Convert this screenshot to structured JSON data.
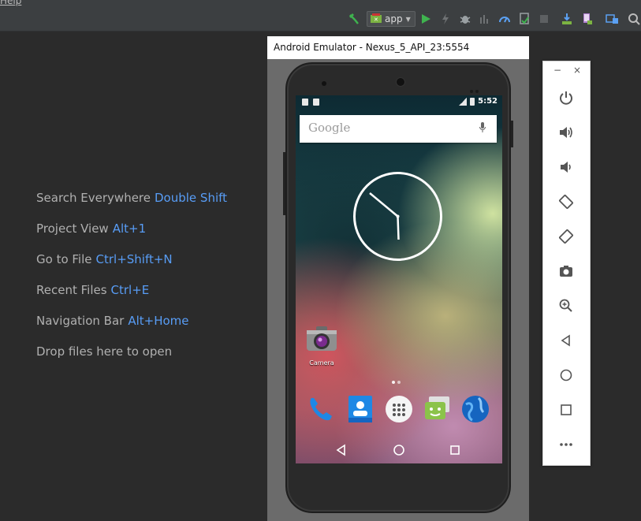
{
  "menubar": {
    "help_label": "Help"
  },
  "toolbar": {
    "run_config": "app",
    "icons": [
      "make-project-icon",
      "run-config-android-icon",
      "run-icon",
      "debug-lightning-icon",
      "debug-bug-icon",
      "profile-icon",
      "sync-icon",
      "coverage-icon",
      "device-stop-icon",
      "sdk-manager-icon",
      "avd-manager-icon",
      "project-structure-icon",
      "search-icon"
    ]
  },
  "welcome": {
    "hints": [
      {
        "label": "Search Everywhere",
        "key": "Double Shift"
      },
      {
        "label": "Project View",
        "key": "Alt+1"
      },
      {
        "label": "Go to File",
        "key": "Ctrl+Shift+N"
      },
      {
        "label": "Recent Files",
        "key": "Ctrl+E"
      },
      {
        "label": "Navigation Bar",
        "key": "Alt+Home"
      },
      {
        "label": "Drop files here to open",
        "key": ""
      }
    ]
  },
  "emulator": {
    "title": "Android Emulator - Nexus_5_API_23:5554",
    "status_time": "5:52",
    "search_placeholder": "Google",
    "clock_time": "5:52",
    "apps": {
      "camera_label": "Camera"
    },
    "dock": [
      "phone-app-icon",
      "contacts-app-icon",
      "app-drawer-icon",
      "messaging-app-icon",
      "browser-app-icon"
    ]
  },
  "side_panel": {
    "window_buttons": {
      "minimize": "−",
      "close": "×"
    },
    "buttons": [
      "power",
      "volume-up",
      "volume-down",
      "rotate-left",
      "rotate-right",
      "screenshot",
      "zoom",
      "back",
      "home",
      "overview",
      "more"
    ]
  },
  "colors": {
    "ide_background": "#2b2b2b",
    "toolbar": "#3c3f41",
    "hint_text": "#b0b0b0",
    "shortcut_text": "#589df6",
    "run_green": "#3fb34f"
  }
}
